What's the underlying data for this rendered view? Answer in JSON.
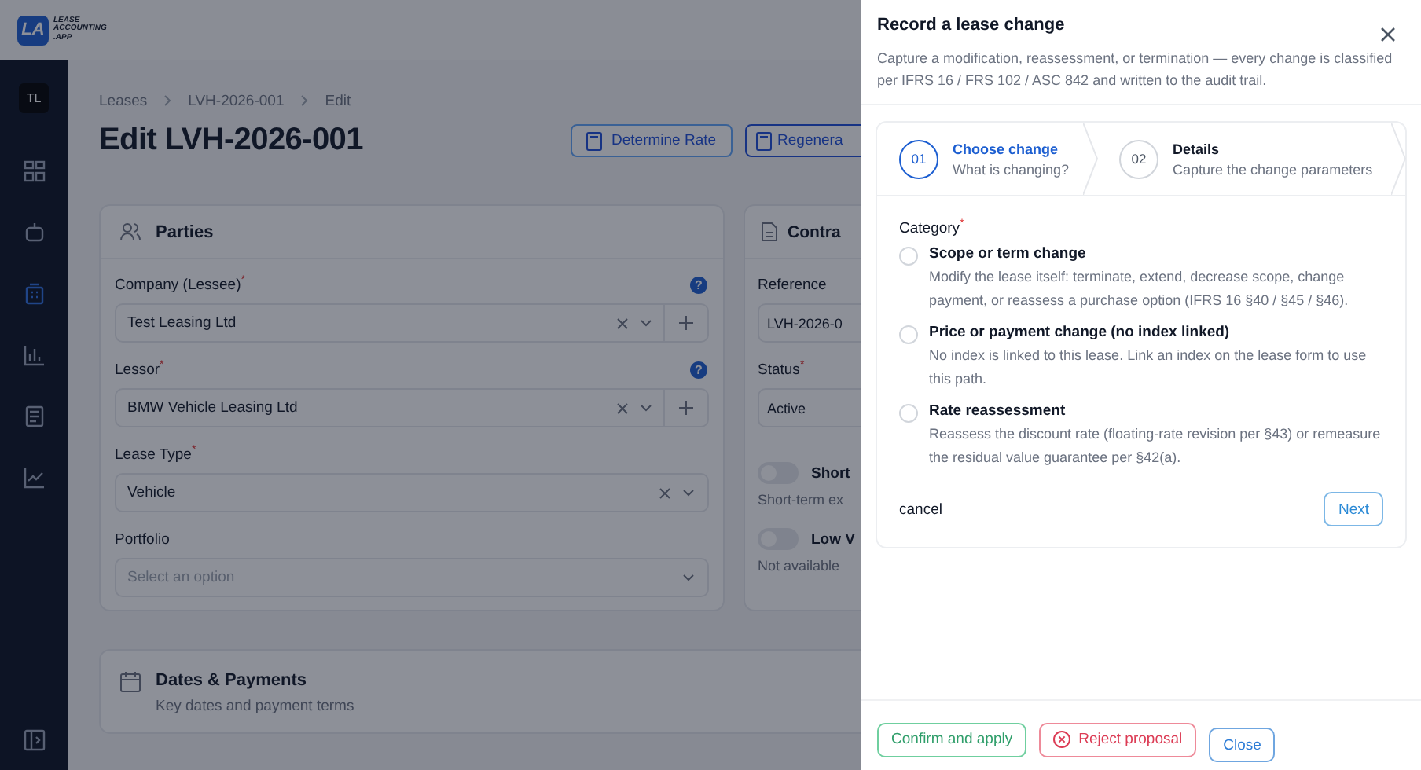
{
  "required_mark": "*",
  "help_mark": "?",
  "app": {
    "logo_mark": "LA",
    "logo_words": [
      "LEASE",
      "ACCOUNTING",
      ".APP"
    ],
    "user_initials": "TL"
  },
  "nav": [
    {
      "selected": false
    },
    {
      "selected": false
    },
    {
      "selected": true
    },
    {
      "selected": false
    },
    {
      "selected": false
    },
    {
      "selected": false
    }
  ],
  "breadcrumb": [
    "Leases",
    "LVH-2026-001",
    "Edit"
  ],
  "page_title": "Edit LVH-2026-001",
  "actions": [
    "Determine Rate",
    "Regenera"
  ],
  "parties": {
    "title": "Parties",
    "fields": [
      {
        "label": "Company (Lessee)",
        "required": true,
        "help": true,
        "value": "Test Leasing Ltd",
        "clearable": true,
        "addable": true
      },
      {
        "label": "Lessor",
        "required": true,
        "help": true,
        "value": "BMW Vehicle Leasing Ltd",
        "clearable": true,
        "addable": true
      },
      {
        "label": "Lease Type",
        "required": true,
        "help": false,
        "value": "Vehicle",
        "clearable": true,
        "addable": false
      },
      {
        "label": "Portfolio",
        "required": false,
        "help": false,
        "placeholder": "Select an option",
        "clearable": false,
        "addable": false
      }
    ]
  },
  "contract": {
    "title": "Contra",
    "fields": [
      {
        "label": "Reference",
        "required": false,
        "value": "LVH-2026-0"
      },
      {
        "label": "Status",
        "required": true,
        "value": "Active"
      }
    ],
    "toggles": [
      {
        "label": "Short",
        "on": false,
        "hint": "Short-term ex"
      },
      {
        "label": "Low V",
        "on": false,
        "hint": "Not available"
      }
    ]
  },
  "dates": {
    "title": "Dates & Payments",
    "subtitle": "Key dates and payment terms"
  },
  "panel": {
    "title": "Record a lease change",
    "description": "Capture a modification, reassessment, or termination — every change is classified per IFRS 16 / FRS 102 / ASC 842 and written to the audit trail.",
    "steps": [
      {
        "number": "01",
        "title": "Choose change",
        "subtitle": "What is changing?",
        "selected": true
      },
      {
        "number": "02",
        "title": "Details",
        "subtitle": "Capture the change parameters",
        "selected": false
      }
    ],
    "category_label": "Category",
    "category_required": true,
    "options": [
      {
        "title": "Scope or term change",
        "description": "Modify the lease itself: terminate, extend, decrease scope, change payment, or reassess a purchase option (IFRS 16 §40 / §45 / §46).",
        "selected": false
      },
      {
        "title": "Price or payment change (no index linked)",
        "description": "No index is linked to this lease. Link an index on the lease form to use this path.",
        "selected": false
      },
      {
        "title": "Rate reassessment",
        "description": "Reassess the discount rate (floating-rate revision per §43) or remeasure the residual value guarantee per §42(a).",
        "selected": false
      }
    ],
    "cancel": "cancel",
    "next": "Next",
    "footer_buttons": [
      {
        "label": "Confirm and apply",
        "kind": "confirm"
      },
      {
        "label": "Reject proposal",
        "kind": "reject"
      },
      {
        "label": "Close",
        "kind": "close"
      }
    ]
  }
}
